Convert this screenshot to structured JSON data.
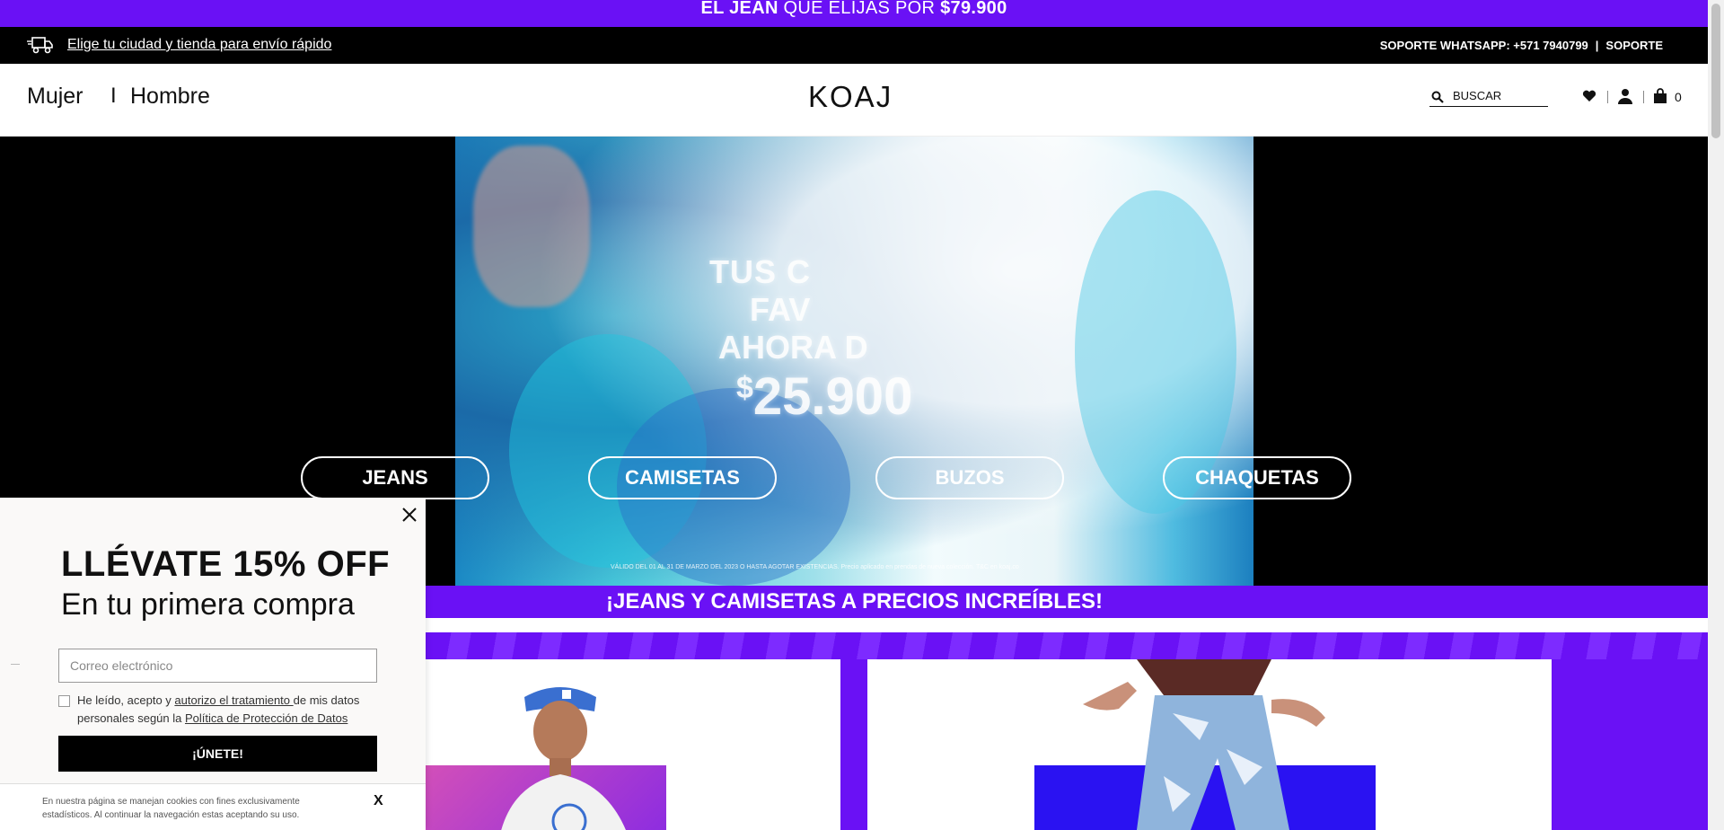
{
  "promo": {
    "part1": "EL JEAN",
    "part2": " QUE ELIJAS POR ",
    "price": "$79.900"
  },
  "utility": {
    "shipping_link": "Elige tu ciudad y tienda para envío rápido",
    "whatsapp": "SOPORTE WHATSAPP: +571 7940799",
    "separator": "|",
    "support": "SOPORTE"
  },
  "header": {
    "nav_women": "Mujer",
    "nav_separator": "I",
    "nav_men": "Hombre",
    "logo": "KOAJ",
    "search_placeholder": "BUSCAR",
    "cart_count": "0"
  },
  "hero": {
    "line1": "TUS C",
    "line2": "FAV",
    "line3": "AHORA D",
    "currency": "$",
    "price": "25.900",
    "legal": "VÁLIDO DEL 01 AL 31 DE MARZO DEL 2023 O HASTA AGOTAR EXISTENCIAS. Precio aplicado en prendas de nueva colección. T&C en koaj.co"
  },
  "categories": [
    "JEANS",
    "CAMISETAS",
    "BUZOS",
    "CHAQUETAS"
  ],
  "highlight_band": "¡JEANS Y CAMISETAS A PRECIOS INCREÍBLES!",
  "popup": {
    "headline": "LLÉVATE 15% OFF",
    "subheadline": "En tu primera compra",
    "email_placeholder": "Correo electrónico",
    "consent_prefix": "He leído, acepto y ",
    "consent_link": "autorizo el tratamiento ",
    "consent_mid": "de mis datos personales según la ",
    "consent_policy": "Política de Protección de Datos",
    "join_button": "¡ÚNETE!"
  },
  "cookie": {
    "text": "En nuestra página se manejan cookies con fines exclusivamente estadísticos. Al continuar la navegación estas aceptando su uso.",
    "close": "X"
  },
  "colors": {
    "brand_purple": "#6a11f5",
    "black": "#000000",
    "white": "#ffffff"
  }
}
